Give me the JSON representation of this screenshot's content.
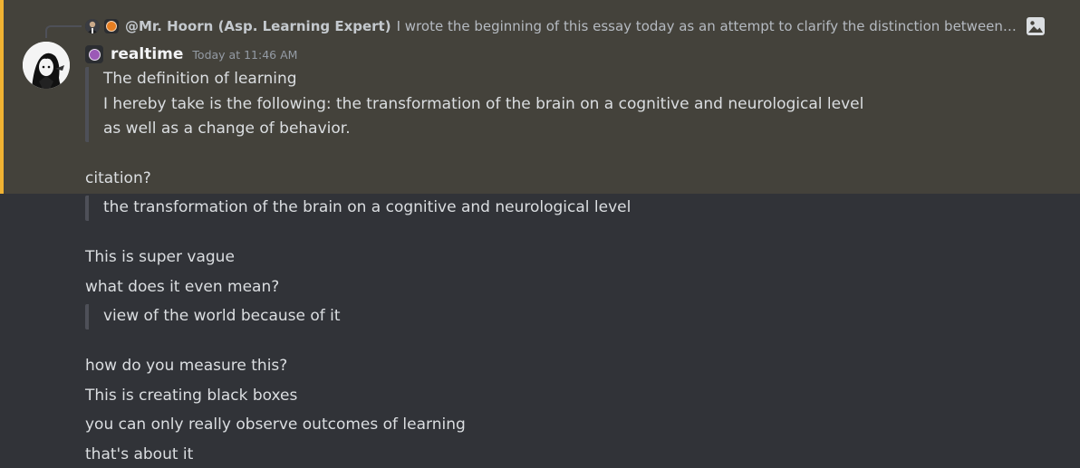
{
  "reply": {
    "author": "@Mr. Hoorn (Asp. Learning Expert)",
    "text": "I wrote the beginning of this essay today as an attempt to clarify the distinction between learn...",
    "badge_color": "#e67e22",
    "icons": [
      "reply-avatar-icon",
      "orange-dot-badge-icon",
      "image-attachment-icon"
    ]
  },
  "message": {
    "author": "realtime",
    "timestamp": "Today at 11:46 AM",
    "author_badge_color": "#9b59b6",
    "highlight_color": "#f0b232",
    "quote1": [
      "The definition of learning",
      "I hereby take is the following: the transformation of the brain on a cognitive and neurological level",
      "as well as a change of behavior."
    ],
    "line_citation": "citation?",
    "quote2": "the transformation of the brain on a cognitive and neurological level",
    "line_vague": "This is super vague",
    "line_mean": "what does it even mean?",
    "quote3": "view of the world because of it",
    "line_measure": "how do you measure this?",
    "line_blackbox": "This is creating black boxes",
    "line_observe": "you can only really observe outcomes of learning",
    "line_about": "that's about it"
  }
}
